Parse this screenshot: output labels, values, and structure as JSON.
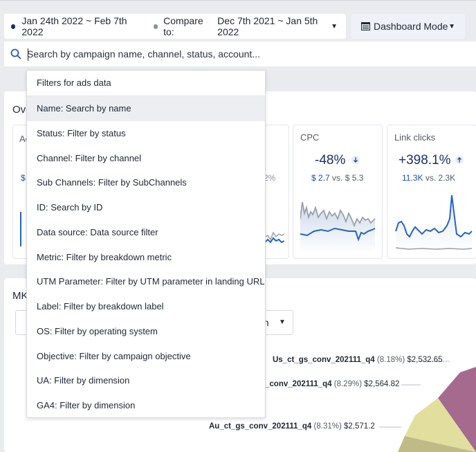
{
  "date_range": {
    "primary": "Jan 24th 2022 ~ Feb 7th 2022",
    "compare_label": "Compare to:",
    "compare": "Dec 7th 2021 ~ Jan 5th 2022"
  },
  "mode": {
    "label": "Dashboard Mode"
  },
  "search": {
    "placeholder": "Search by campaign name, channel, status, account..."
  },
  "overview": {
    "title_visible": "Ove",
    "partial_card_title": "Ac",
    "partial_card_value": "$",
    "partial_card_pct": "2%",
    "cards": [
      {
        "title": "CPC",
        "change": "-48%",
        "direction": "down",
        "current": "$ 2.7",
        "vs": "vs.",
        "previous": "$ 5.3"
      },
      {
        "title": "Link clicks",
        "change": "+398.1%",
        "direction": "up",
        "current": "11.3K",
        "vs": "vs.",
        "previous": "2.3K"
      }
    ]
  },
  "mkt": {
    "title_visible": "MK",
    "select_value": "gn",
    "pie_labels": [
      {
        "name": "Us_ct_gs_conv_202111_q4",
        "pct": "(8.18%)",
        "value": "$2,532.65"
      },
      {
        "name": "_conv_202111_q4",
        "pct": "(8.29%)",
        "value": "$2,564.82"
      },
      {
        "name": "Au_ct_gs_conv_202111_q4",
        "pct": "(8.31%)",
        "value": "$2,571.2"
      }
    ]
  },
  "dropdown": {
    "header": "Filters for ads data",
    "items": [
      {
        "field": "Name",
        "desc": "Search by name"
      },
      {
        "field": "Status",
        "desc": "Filter by status"
      },
      {
        "field": "Channel",
        "desc": "Filter by channel"
      },
      {
        "field": "Sub Channels",
        "desc": "Filter by SubChannels"
      },
      {
        "field": "ID",
        "desc": "Search by ID"
      },
      {
        "field": "Data source",
        "desc": "Data source filter"
      },
      {
        "field": "Metric",
        "desc": "Filter by breakdown metric"
      },
      {
        "field": "UTM Parameter",
        "desc": "Filter by UTM parameter in landing URL"
      },
      {
        "field": "Label",
        "desc": "Filter by breakdown label"
      },
      {
        "field": "OS",
        "desc": "Filter by operating system"
      },
      {
        "field": "Objective",
        "desc": "Filter by campaign objective"
      },
      {
        "field": "UA",
        "desc": "Filter by dimension"
      },
      {
        "field": "GA4",
        "desc": "Filter by dimension"
      }
    ]
  },
  "colors": {
    "accent_navy": "#17306a",
    "series_blue": "#2563c9",
    "compare_grey": "#9aa0a8",
    "pie_mauve": "#a56a8e",
    "pie_pale_yellow": "#e2de9e",
    "pie_olive": "#c0bb86"
  }
}
